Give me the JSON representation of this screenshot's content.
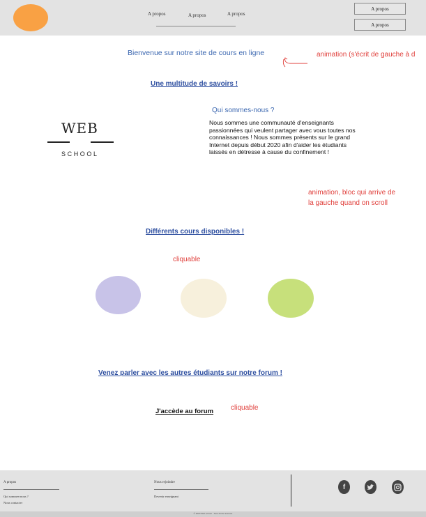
{
  "header": {
    "nav": [
      "A propos",
      "A propos",
      "A propos"
    ],
    "buttons": [
      "A propos",
      "A propos"
    ],
    "logo_color": "#f9a144"
  },
  "welcome": {
    "text": "Bienvenue sur notre site de cours en ligne",
    "note": "animation (s'écrit de gauche à d"
  },
  "savoirs_link": "Une multitude de savoirs !",
  "logo": {
    "top": "WEB",
    "bottom": "SCHOOL"
  },
  "about": {
    "title": "Qui sommes-nous ?",
    "paragraph": "Nous sommes une communauté d'enseignants passionnées qui veulent partager avec vous toutes nos connaissances ! Nous sommes présents sur le grand Internet depuis début 2020 afin d'aider les étudiants laissés en détresse à cause du confinement !",
    "note_line1": "animation, bloc qui arrive de",
    "note_line2": "la gauche quand on scroll"
  },
  "courses": {
    "heading": "Différents cours disponibles !",
    "note": "cliquable",
    "colors": [
      "#c8c3e8",
      "#f7f0dc",
      "#c7e07b"
    ]
  },
  "forum": {
    "heading": "Venez parler avec les autres étudiants sur notre forum !",
    "button": "J'accède au forum",
    "note": "cliquable"
  },
  "footer": {
    "col1_title": "A propos",
    "col1_links": [
      "Qui sommes-nous ?",
      "Nous contacter"
    ],
    "col2_title": "Nous rejoindre",
    "col2_links": [
      "Devenir enseignant"
    ],
    "social": [
      "facebook-icon",
      "twitter-icon",
      "instagram-icon"
    ],
    "copyright": "© 2020 Web school · Tous droits réservés"
  },
  "accent_color": "#3b67b0",
  "note_color": "#e0403c"
}
